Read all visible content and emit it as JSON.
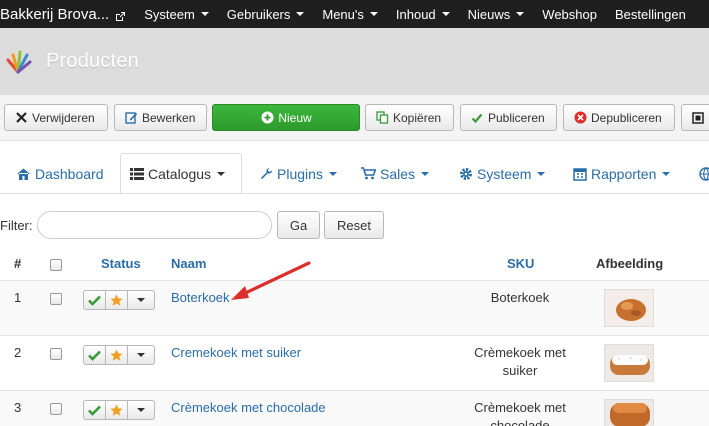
{
  "navbar": {
    "brand": "Bakkerij Brova...",
    "items": [
      {
        "label": "Systeem"
      },
      {
        "label": "Gebruikers"
      },
      {
        "label": "Menu's"
      },
      {
        "label": "Inhoud"
      },
      {
        "label": "Nieuws"
      },
      {
        "label": "Webshop"
      },
      {
        "label": "Bestellingen"
      }
    ]
  },
  "header": {
    "title": "Producten"
  },
  "toolbar": {
    "delete": "Verwijderen",
    "edit": "Bewerken",
    "new": "Nieuw",
    "copy": "Kopiëren",
    "publish": "Publiceren",
    "unpublish": "Depubliceren"
  },
  "tabs": [
    {
      "label": "Dashboard",
      "icon": "home-icon"
    },
    {
      "label": "Catalogus",
      "icon": "list-icon"
    },
    {
      "label": "Plugins",
      "icon": "wrench-icon"
    },
    {
      "label": "Sales",
      "icon": "cart-icon"
    },
    {
      "label": "Systeem",
      "icon": "gear-icon"
    },
    {
      "label": "Rapporten",
      "icon": "calendar-icon"
    }
  ],
  "filter": {
    "label": "Filter:",
    "value": "",
    "go": "Ga",
    "reset": "Reset"
  },
  "table": {
    "headers": {
      "num": "#",
      "status": "Status",
      "name": "Naam",
      "sku": "SKU",
      "image": "Afbeelding"
    },
    "rows": [
      {
        "num": "1",
        "name": "Boterkoek",
        "sku_line1": "Boterkoek",
        "sku_line2": ""
      },
      {
        "num": "2",
        "name": "Cremekoek met suiker",
        "sku_line1": "Crèmekoek met",
        "sku_line2": "suiker"
      },
      {
        "num": "3",
        "name": "Crèmekoek met chocolade",
        "sku_line1": "Crèmekoek met",
        "sku_line2": "chocolade"
      }
    ]
  },
  "colors": {
    "navbar_bg": "#1f1f1f",
    "header_bg": "#dcdcdc",
    "link": "#2a6da8",
    "new_button": "#2d9a2d",
    "annotation_arrow": "#d9302c",
    "check": "#3a9a3a",
    "star": "#f0a020"
  }
}
